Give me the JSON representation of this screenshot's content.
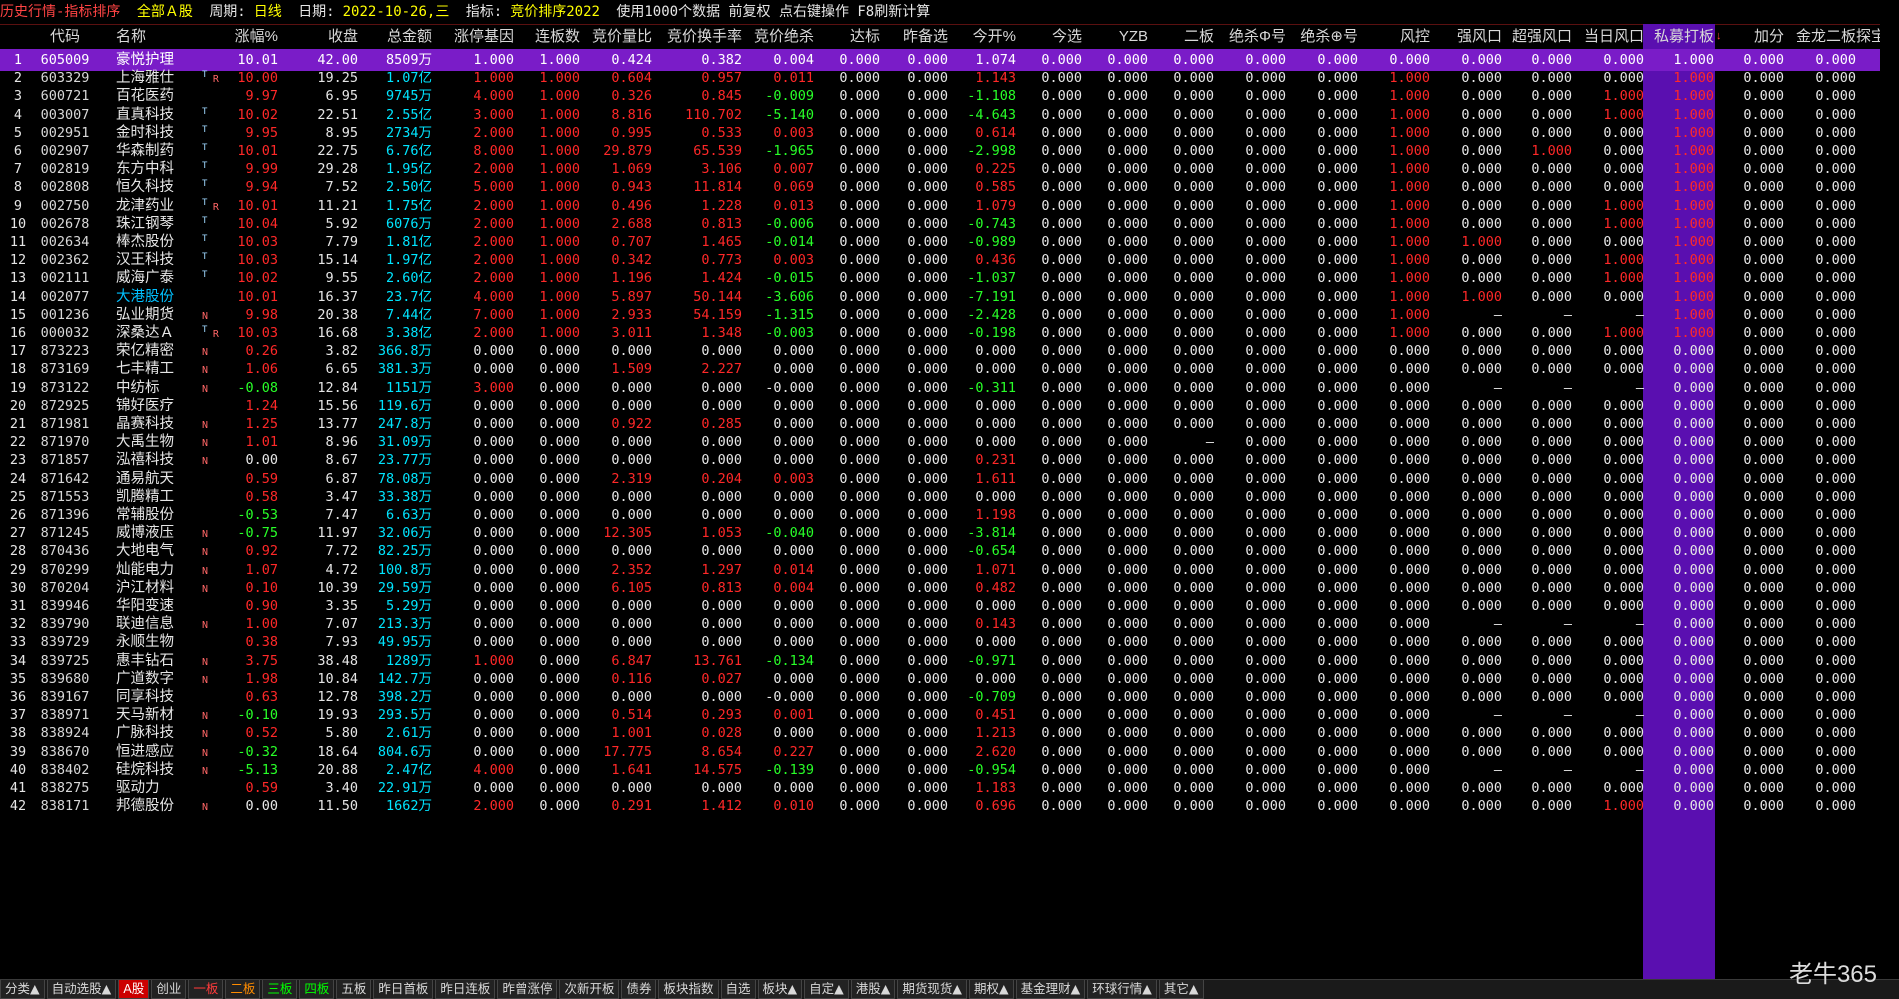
{
  "title": {
    "app": "历史行情-指标排序",
    "market": "全部Ａ股",
    "period_label": "周期:",
    "period": "日线",
    "date_label": "日期:",
    "date": "2022-10-26,三",
    "indicator_label": "指标:",
    "indicator": "竞价排序2022",
    "info": "使用1000个数据 前复权 点右键操作 F8刷新计算"
  },
  "columns": [
    "",
    "代码",
    "名称",
    "",
    "涨幅%",
    "收盘",
    "总金额",
    "涨停基因",
    "连板数",
    "竞价量比",
    "竞价换手率",
    "竞价绝杀",
    "达标",
    "昨备选",
    "今开%",
    "今选",
    "YZB",
    "二板",
    "绝杀Φ号",
    "绝杀⊕号",
    "风控",
    "强风口",
    "超强风口",
    "当日风口",
    "私募打板",
    "",
    "加分",
    "金龙二板",
    "探宝"
  ],
  "colors": {
    "accent": "#7a1cc8",
    "column_highlight": "#5a0fb0",
    "up": "#ff2828",
    "down": "#28ff28"
  },
  "rows": [
    [
      "1",
      "605009",
      "豪悦护理",
      "",
      "10.01",
      "42.00",
      "8509万",
      "1.000",
      "1.000",
      "0.424",
      "0.382",
      "0.004",
      "0.000",
      "0.000",
      "1.074",
      "0.000",
      "0.000",
      "0.000",
      "0.000",
      "0.000",
      "0.000",
      "0.000",
      "0.000",
      "0.000",
      "1.000",
      "",
      "0.000",
      "0.000"
    ],
    [
      "2",
      "603329",
      "上海雅仕",
      "T R",
      "10.00",
      "19.25",
      "1.07亿",
      "1.000",
      "1.000",
      "0.604",
      "0.957",
      "0.011",
      "0.000",
      "0.000",
      "1.143",
      "0.000",
      "0.000",
      "0.000",
      "0.000",
      "0.000",
      "1.000",
      "0.000",
      "0.000",
      "0.000",
      "1.000",
      "",
      "0.000",
      "0.000"
    ],
    [
      "3",
      "600721",
      "百花医药",
      "",
      "9.97",
      "6.95",
      "9745万",
      "4.000",
      "1.000",
      "0.326",
      "0.845",
      "-0.009",
      "0.000",
      "0.000",
      "-1.108",
      "0.000",
      "0.000",
      "0.000",
      "0.000",
      "0.000",
      "1.000",
      "0.000",
      "0.000",
      "1.000",
      "1.000",
      "",
      "0.000",
      "0.000"
    ],
    [
      "4",
      "003007",
      "直真科技",
      "T",
      "10.02",
      "22.51",
      "2.55亿",
      "3.000",
      "1.000",
      "8.816",
      "110.702",
      "-5.140",
      "0.000",
      "0.000",
      "-4.643",
      "0.000",
      "0.000",
      "0.000",
      "0.000",
      "0.000",
      "1.000",
      "0.000",
      "0.000",
      "1.000",
      "1.000",
      "",
      "0.000",
      "0.000"
    ],
    [
      "5",
      "002951",
      "金时科技",
      "T",
      "9.95",
      "8.95",
      "2734万",
      "2.000",
      "1.000",
      "0.995",
      "0.533",
      "0.003",
      "0.000",
      "0.000",
      "0.614",
      "0.000",
      "0.000",
      "0.000",
      "0.000",
      "0.000",
      "1.000",
      "0.000",
      "0.000",
      "0.000",
      "1.000",
      "",
      "0.000",
      "0.000"
    ],
    [
      "6",
      "002907",
      "华森制药",
      "T",
      "10.01",
      "22.75",
      "6.76亿",
      "8.000",
      "1.000",
      "29.879",
      "65.539",
      "-1.965",
      "0.000",
      "0.000",
      "-2.998",
      "0.000",
      "0.000",
      "0.000",
      "0.000",
      "0.000",
      "1.000",
      "0.000",
      "1.000",
      "0.000",
      "1.000",
      "",
      "0.000",
      "0.000"
    ],
    [
      "7",
      "002819",
      "东方中科",
      "T",
      "9.99",
      "29.28",
      "1.95亿",
      "2.000",
      "1.000",
      "1.069",
      "3.106",
      "0.007",
      "0.000",
      "0.000",
      "0.225",
      "0.000",
      "0.000",
      "0.000",
      "0.000",
      "0.000",
      "1.000",
      "0.000",
      "0.000",
      "0.000",
      "1.000",
      "",
      "0.000",
      "0.000"
    ],
    [
      "8",
      "002808",
      "恒久科技",
      "T",
      "9.94",
      "7.52",
      "2.50亿",
      "5.000",
      "1.000",
      "0.943",
      "11.814",
      "0.069",
      "0.000",
      "0.000",
      "0.585",
      "0.000",
      "0.000",
      "0.000",
      "0.000",
      "0.000",
      "1.000",
      "0.000",
      "0.000",
      "0.000",
      "1.000",
      "",
      "0.000",
      "0.000"
    ],
    [
      "9",
      "002750",
      "龙津药业",
      "T R",
      "10.01",
      "11.21",
      "1.75亿",
      "2.000",
      "1.000",
      "0.496",
      "1.228",
      "0.013",
      "0.000",
      "0.000",
      "1.079",
      "0.000",
      "0.000",
      "0.000",
      "0.000",
      "0.000",
      "1.000",
      "0.000",
      "0.000",
      "1.000",
      "1.000",
      "",
      "0.000",
      "0.000"
    ],
    [
      "10",
      "002678",
      "珠江钢琴",
      "T",
      "10.04",
      "5.92",
      "6076万",
      "2.000",
      "1.000",
      "2.688",
      "0.813",
      "-0.006",
      "0.000",
      "0.000",
      "-0.743",
      "0.000",
      "0.000",
      "0.000",
      "0.000",
      "0.000",
      "1.000",
      "0.000",
      "0.000",
      "1.000",
      "1.000",
      "",
      "0.000",
      "0.000"
    ],
    [
      "11",
      "002634",
      "棒杰股份",
      "T",
      "10.03",
      "7.79",
      "1.81亿",
      "2.000",
      "1.000",
      "0.707",
      "1.465",
      "-0.014",
      "0.000",
      "0.000",
      "-0.989",
      "0.000",
      "0.000",
      "0.000",
      "0.000",
      "0.000",
      "1.000",
      "1.000",
      "0.000",
      "0.000",
      "1.000",
      "",
      "0.000",
      "0.000"
    ],
    [
      "12",
      "002362",
      "汉王科技",
      "T",
      "10.03",
      "15.14",
      "1.97亿",
      "2.000",
      "1.000",
      "0.342",
      "0.773",
      "0.003",
      "0.000",
      "0.000",
      "0.436",
      "0.000",
      "0.000",
      "0.000",
      "0.000",
      "0.000",
      "1.000",
      "0.000",
      "0.000",
      "1.000",
      "1.000",
      "",
      "0.000",
      "0.000"
    ],
    [
      "13",
      "002111",
      "威海广泰",
      "T",
      "10.02",
      "9.55",
      "2.60亿",
      "2.000",
      "1.000",
      "1.196",
      "1.424",
      "-0.015",
      "0.000",
      "0.000",
      "-1.037",
      "0.000",
      "0.000",
      "0.000",
      "0.000",
      "0.000",
      "1.000",
      "0.000",
      "0.000",
      "1.000",
      "1.000",
      "",
      "0.000",
      "0.000"
    ],
    [
      "14",
      "002077",
      "大港股份",
      "",
      "10.01",
      "16.37",
      "23.7亿",
      "4.000",
      "1.000",
      "5.897",
      "50.144",
      "-3.606",
      "0.000",
      "0.000",
      "-7.191",
      "0.000",
      "0.000",
      "0.000",
      "0.000",
      "0.000",
      "1.000",
      "1.000",
      "0.000",
      "0.000",
      "1.000",
      "",
      "0.000",
      "0.000"
    ],
    [
      "15",
      "001236",
      "弘业期货",
      "N",
      "9.98",
      "20.38",
      "7.44亿",
      "7.000",
      "1.000",
      "2.933",
      "54.159",
      "-1.315",
      "0.000",
      "0.000",
      "-2.428",
      "0.000",
      "0.000",
      "0.000",
      "0.000",
      "0.000",
      "1.000",
      "—",
      "—",
      "—",
      "1.000",
      "",
      "0.000",
      "0.000"
    ],
    [
      "16",
      "000032",
      "深桑达Ａ",
      "T R",
      "10.03",
      "16.68",
      "3.38亿",
      "2.000",
      "1.000",
      "3.011",
      "1.348",
      "-0.003",
      "0.000",
      "0.000",
      "-0.198",
      "0.000",
      "0.000",
      "0.000",
      "0.000",
      "0.000",
      "1.000",
      "0.000",
      "0.000",
      "1.000",
      "1.000",
      "",
      "0.000",
      "0.000"
    ],
    [
      "17",
      "873223",
      "荣亿精密",
      "N",
      "0.26",
      "3.82",
      "366.8万",
      "0.000",
      "0.000",
      "0.000",
      "0.000",
      "0.000",
      "0.000",
      "0.000",
      "0.000",
      "0.000",
      "0.000",
      "0.000",
      "0.000",
      "0.000",
      "0.000",
      "0.000",
      "0.000",
      "0.000",
      "0.000",
      "",
      "0.000",
      "0.000"
    ],
    [
      "18",
      "873169",
      "七丰精工",
      "N",
      "1.06",
      "6.65",
      "381.3万",
      "0.000",
      "0.000",
      "1.509",
      "2.227",
      "0.000",
      "0.000",
      "0.000",
      "0.000",
      "0.000",
      "0.000",
      "0.000",
      "0.000",
      "0.000",
      "0.000",
      "0.000",
      "0.000",
      "0.000",
      "0.000",
      "",
      "0.000",
      "0.000"
    ],
    [
      "19",
      "873122",
      "中纺标",
      "N",
      "-0.08",
      "12.84",
      "1151万",
      "3.000",
      "0.000",
      "0.000",
      "0.000",
      "-0.000",
      "0.000",
      "0.000",
      "-0.311",
      "0.000",
      "0.000",
      "0.000",
      "0.000",
      "0.000",
      "0.000",
      "—",
      "—",
      "—",
      "0.000",
      "",
      "0.000",
      "0.000"
    ],
    [
      "20",
      "872925",
      "锦好医疗",
      "",
      "1.24",
      "15.56",
      "119.6万",
      "0.000",
      "0.000",
      "0.000",
      "0.000",
      "0.000",
      "0.000",
      "0.000",
      "0.000",
      "0.000",
      "0.000",
      "0.000",
      "0.000",
      "0.000",
      "0.000",
      "0.000",
      "0.000",
      "0.000",
      "0.000",
      "",
      "0.000",
      "0.000"
    ],
    [
      "21",
      "871981",
      "晶赛科技",
      "N",
      "1.25",
      "13.77",
      "247.8万",
      "0.000",
      "0.000",
      "0.922",
      "0.285",
      "0.000",
      "0.000",
      "0.000",
      "0.000",
      "0.000",
      "0.000",
      "0.000",
      "0.000",
      "0.000",
      "0.000",
      "0.000",
      "0.000",
      "0.000",
      "0.000",
      "",
      "0.000",
      "0.000"
    ],
    [
      "22",
      "871970",
      "大禹生物",
      "N",
      "1.01",
      "8.96",
      "31.09万",
      "0.000",
      "0.000",
      "0.000",
      "0.000",
      "0.000",
      "0.000",
      "0.000",
      "0.000",
      "0.000",
      "0.000",
      "—",
      "0.000",
      "0.000",
      "0.000",
      "0.000",
      "0.000",
      "0.000",
      "0.000",
      "",
      "0.000",
      "0.000"
    ],
    [
      "23",
      "871857",
      "泓禧科技",
      "N",
      "0.00",
      "8.67",
      "23.77万",
      "0.000",
      "0.000",
      "0.000",
      "0.000",
      "0.000",
      "0.000",
      "0.000",
      "0.231",
      "0.000",
      "0.000",
      "0.000",
      "0.000",
      "0.000",
      "0.000",
      "0.000",
      "0.000",
      "0.000",
      "0.000",
      "",
      "0.000",
      "0.000"
    ],
    [
      "24",
      "871642",
      "通易航天",
      "",
      "0.59",
      "6.87",
      "78.08万",
      "0.000",
      "0.000",
      "2.319",
      "0.204",
      "0.003",
      "0.000",
      "0.000",
      "1.611",
      "0.000",
      "0.000",
      "0.000",
      "0.000",
      "0.000",
      "0.000",
      "0.000",
      "0.000",
      "0.000",
      "0.000",
      "",
      "0.000",
      "0.000"
    ],
    [
      "25",
      "871553",
      "凯腾精工",
      "",
      "0.58",
      "3.47",
      "33.38万",
      "0.000",
      "0.000",
      "0.000",
      "0.000",
      "0.000",
      "0.000",
      "0.000",
      "0.000",
      "0.000",
      "0.000",
      "0.000",
      "0.000",
      "0.000",
      "0.000",
      "0.000",
      "0.000",
      "0.000",
      "0.000",
      "",
      "0.000",
      "0.000"
    ],
    [
      "26",
      "871396",
      "常辅股份",
      "",
      "-0.53",
      "7.47",
      "6.63万",
      "0.000",
      "0.000",
      "0.000",
      "0.000",
      "0.000",
      "0.000",
      "0.000",
      "1.198",
      "0.000",
      "0.000",
      "0.000",
      "0.000",
      "0.000",
      "0.000",
      "0.000",
      "0.000",
      "0.000",
      "0.000",
      "",
      "0.000",
      "0.000"
    ],
    [
      "27",
      "871245",
      "威博液压",
      "N",
      "-0.75",
      "11.97",
      "32.06万",
      "0.000",
      "0.000",
      "12.305",
      "1.053",
      "-0.040",
      "0.000",
      "0.000",
      "-3.814",
      "0.000",
      "0.000",
      "0.000",
      "0.000",
      "0.000",
      "0.000",
      "0.000",
      "0.000",
      "0.000",
      "0.000",
      "",
      "0.000",
      "0.000"
    ],
    [
      "28",
      "870436",
      "大地电气",
      "N",
      "0.92",
      "7.72",
      "82.25万",
      "0.000",
      "0.000",
      "0.000",
      "0.000",
      "0.000",
      "0.000",
      "0.000",
      "-0.654",
      "0.000",
      "0.000",
      "0.000",
      "0.000",
      "0.000",
      "0.000",
      "0.000",
      "0.000",
      "0.000",
      "0.000",
      "",
      "0.000",
      "0.000"
    ],
    [
      "29",
      "870299",
      "灿能电力",
      "N",
      "1.07",
      "4.72",
      "100.8万",
      "0.000",
      "0.000",
      "2.352",
      "1.297",
      "0.014",
      "0.000",
      "0.000",
      "1.071",
      "0.000",
      "0.000",
      "0.000",
      "0.000",
      "0.000",
      "0.000",
      "0.000",
      "0.000",
      "0.000",
      "0.000",
      "",
      "0.000",
      "0.000"
    ],
    [
      "30",
      "870204",
      "沪江材料",
      "N",
      "0.10",
      "10.39",
      "29.59万",
      "0.000",
      "0.000",
      "6.105",
      "0.813",
      "0.004",
      "0.000",
      "0.000",
      "0.482",
      "0.000",
      "0.000",
      "0.000",
      "0.000",
      "0.000",
      "0.000",
      "0.000",
      "0.000",
      "0.000",
      "0.000",
      "",
      "0.000",
      "0.000"
    ],
    [
      "31",
      "839946",
      "华阳变速",
      "",
      "0.90",
      "3.35",
      "5.29万",
      "0.000",
      "0.000",
      "0.000",
      "0.000",
      "0.000",
      "0.000",
      "0.000",
      "0.000",
      "0.000",
      "0.000",
      "0.000",
      "0.000",
      "0.000",
      "0.000",
      "0.000",
      "0.000",
      "0.000",
      "0.000",
      "",
      "0.000",
      "0.000"
    ],
    [
      "32",
      "839790",
      "联迪信息",
      "N",
      "1.00",
      "7.07",
      "213.3万",
      "0.000",
      "0.000",
      "0.000",
      "0.000",
      "0.000",
      "0.000",
      "0.000",
      "0.143",
      "0.000",
      "0.000",
      "0.000",
      "0.000",
      "0.000",
      "0.000",
      "—",
      "—",
      "—",
      "0.000",
      "",
      "0.000",
      "0.000"
    ],
    [
      "33",
      "839729",
      "永顺生物",
      "",
      "0.38",
      "7.93",
      "49.95万",
      "0.000",
      "0.000",
      "0.000",
      "0.000",
      "0.000",
      "0.000",
      "0.000",
      "0.000",
      "0.000",
      "0.000",
      "0.000",
      "0.000",
      "0.000",
      "0.000",
      "0.000",
      "0.000",
      "0.000",
      "0.000",
      "",
      "0.000",
      "0.000"
    ],
    [
      "34",
      "839725",
      "惠丰钻石",
      "N",
      "3.75",
      "38.48",
      "1289万",
      "1.000",
      "0.000",
      "6.847",
      "13.761",
      "-0.134",
      "0.000",
      "0.000",
      "-0.971",
      "0.000",
      "0.000",
      "0.000",
      "0.000",
      "0.000",
      "0.000",
      "0.000",
      "0.000",
      "0.000",
      "0.000",
      "",
      "0.000",
      "0.000"
    ],
    [
      "35",
      "839680",
      "广道数字",
      "N",
      "1.98",
      "10.84",
      "142.7万",
      "0.000",
      "0.000",
      "0.116",
      "0.027",
      "0.000",
      "0.000",
      "0.000",
      "0.000",
      "0.000",
      "0.000",
      "0.000",
      "0.000",
      "0.000",
      "0.000",
      "0.000",
      "0.000",
      "0.000",
      "0.000",
      "",
      "0.000",
      "0.000"
    ],
    [
      "36",
      "839167",
      "同享科技",
      "",
      "0.63",
      "12.78",
      "398.2万",
      "0.000",
      "0.000",
      "0.000",
      "0.000",
      "-0.000",
      "0.000",
      "0.000",
      "-0.709",
      "0.000",
      "0.000",
      "0.000",
      "0.000",
      "0.000",
      "0.000",
      "0.000",
      "0.000",
      "0.000",
      "0.000",
      "",
      "0.000",
      "0.000"
    ],
    [
      "37",
      "838971",
      "天马新材",
      "N",
      "-0.10",
      "19.93",
      "293.5万",
      "0.000",
      "0.000",
      "0.514",
      "0.293",
      "0.001",
      "0.000",
      "0.000",
      "0.451",
      "0.000",
      "0.000",
      "0.000",
      "0.000",
      "0.000",
      "0.000",
      "—",
      "—",
      "—",
      "0.000",
      "",
      "0.000",
      "0.000"
    ],
    [
      "38",
      "838924",
      "广脉科技",
      "N",
      "0.52",
      "5.80",
      "2.61万",
      "0.000",
      "0.000",
      "1.001",
      "0.028",
      "0.000",
      "0.000",
      "0.000",
      "1.213",
      "0.000",
      "0.000",
      "0.000",
      "0.000",
      "0.000",
      "0.000",
      "0.000",
      "0.000",
      "0.000",
      "0.000",
      "",
      "0.000",
      "0.000"
    ],
    [
      "39",
      "838670",
      "恒进感应",
      "N",
      "-0.32",
      "18.64",
      "804.6万",
      "0.000",
      "0.000",
      "17.775",
      "8.654",
      "0.227",
      "0.000",
      "0.000",
      "2.620",
      "0.000",
      "0.000",
      "0.000",
      "0.000",
      "0.000",
      "0.000",
      "0.000",
      "0.000",
      "0.000",
      "0.000",
      "",
      "0.000",
      "0.000"
    ],
    [
      "40",
      "838402",
      "硅烷科技",
      "N",
      "-5.13",
      "20.88",
      "2.47亿",
      "4.000",
      "0.000",
      "1.641",
      "14.575",
      "-0.139",
      "0.000",
      "0.000",
      "-0.954",
      "0.000",
      "0.000",
      "0.000",
      "0.000",
      "0.000",
      "0.000",
      "—",
      "—",
      "—",
      "0.000",
      "",
      "0.000",
      "0.000"
    ],
    [
      "41",
      "838275",
      "驱动力",
      "",
      "0.59",
      "3.40",
      "22.91万",
      "0.000",
      "0.000",
      "0.000",
      "0.000",
      "0.000",
      "0.000",
      "0.000",
      "1.183",
      "0.000",
      "0.000",
      "0.000",
      "0.000",
      "0.000",
      "0.000",
      "0.000",
      "0.000",
      "0.000",
      "0.000",
      "",
      "0.000",
      "0.000"
    ],
    [
      "42",
      "838171",
      "邦德股份",
      "N",
      "0.00",
      "11.50",
      "1662万",
      "2.000",
      "0.000",
      "0.291",
      "1.412",
      "0.010",
      "0.000",
      "0.000",
      "0.696",
      "0.000",
      "0.000",
      "0.000",
      "0.000",
      "0.000",
      "0.000",
      "0.000",
      "0.000",
      "1.000",
      "0.000",
      "",
      "0.000",
      "0.000"
    ]
  ],
  "tabs": [
    "分类▲",
    "自动选股▲",
    "A股",
    "创业",
    "一板",
    "二板",
    "三板",
    "四板",
    "五板",
    "昨日首板",
    "昨日连板",
    "昨曾涨停",
    "次新开板",
    "债券",
    "板块指数",
    "自选",
    "板块▲",
    "自定▲",
    "港股▲",
    "期货现货▲",
    "期权▲",
    "基金理财▲",
    "环球行情▲",
    "其它▲"
  ],
  "logo": "老牛365"
}
